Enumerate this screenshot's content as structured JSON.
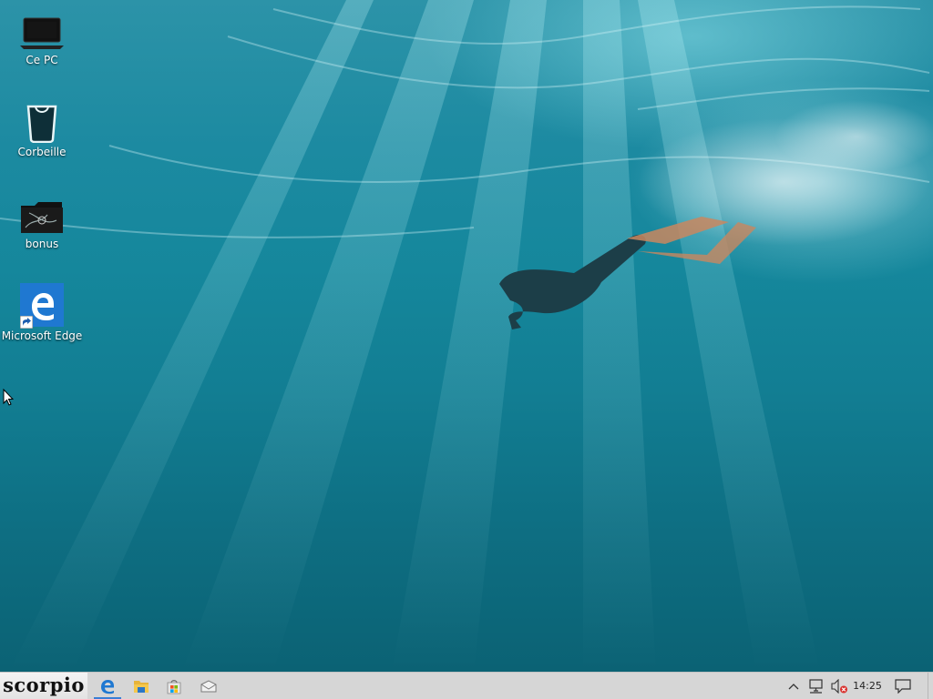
{
  "desktop": {
    "icons": [
      {
        "label": "Ce PC",
        "icon": "this-pc-icon"
      },
      {
        "label": "Corbeille",
        "icon": "recycle-bin-icon"
      },
      {
        "label": "bonus",
        "icon": "folder-icon"
      },
      {
        "label": "Microsoft Edge",
        "icon": "edge-icon"
      }
    ]
  },
  "taskbar": {
    "start_label": "scorpio",
    "pinned": [
      {
        "name": "Microsoft Edge",
        "icon": "edge-icon",
        "active": true
      },
      {
        "name": "Explorateur de fichiers",
        "icon": "file-explorer-icon",
        "active": false
      },
      {
        "name": "Store",
        "icon": "store-icon",
        "active": false
      },
      {
        "name": "Courrier",
        "icon": "mail-icon",
        "active": false
      }
    ],
    "tray": {
      "clock": "14:25",
      "icons": [
        "chevron-up-icon",
        "network-icon",
        "volume-muted-icon",
        "notification-icon"
      ]
    }
  },
  "colors": {
    "taskbar": "#d6d6d6",
    "edge_blue": "#1f78d1",
    "water": "#15879c"
  }
}
